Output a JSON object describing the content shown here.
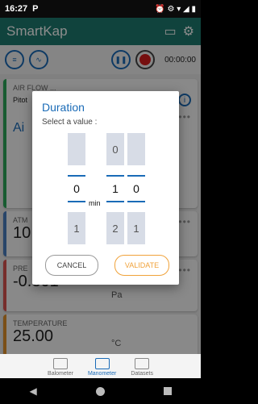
{
  "status": {
    "time": "16:27",
    "p_icon": "P",
    "right_icons": "⏰ ⚙ ▾ ◢ ▮"
  },
  "app": {
    "title": "SmartKap",
    "icons": {
      "save": "save-icon",
      "settings": "gear-icon"
    }
  },
  "toolbar": {
    "timer": "00:00:00"
  },
  "cards": {
    "airflow": {
      "label": "AIR FLOW ...",
      "select_value": "Pitot",
      "big_text": "Ai"
    },
    "atm": {
      "label": "ATM",
      "value": "10"
    },
    "pressure": {
      "label": "PRE",
      "value": "-0.301",
      "unit": "Pa"
    },
    "temperature": {
      "label": "TEMPERATURE",
      "value": "25.00",
      "unit": "°C"
    }
  },
  "dialog": {
    "title": "Duration",
    "subtitle": "Select a value :",
    "unit_label": "min",
    "picker_minutes": {
      "above": "",
      "selected": "0",
      "below": "1"
    },
    "picker_sec_tens": {
      "above": "0",
      "selected": "1",
      "below": "2"
    },
    "picker_sec_ones": {
      "above": "",
      "selected": "0",
      "below": "1"
    },
    "cancel_label": "CANCEL",
    "validate_label": "VALIDATE"
  },
  "nav": {
    "items": [
      {
        "label": "Balometer"
      },
      {
        "label": "Manometer"
      },
      {
        "label": "Datasets"
      }
    ],
    "active": "Manometer"
  },
  "colors": {
    "primary": "#1e7b6f",
    "accent": "#1a6bb7",
    "validate": "#f0a23a",
    "record": "#d81c1c"
  }
}
